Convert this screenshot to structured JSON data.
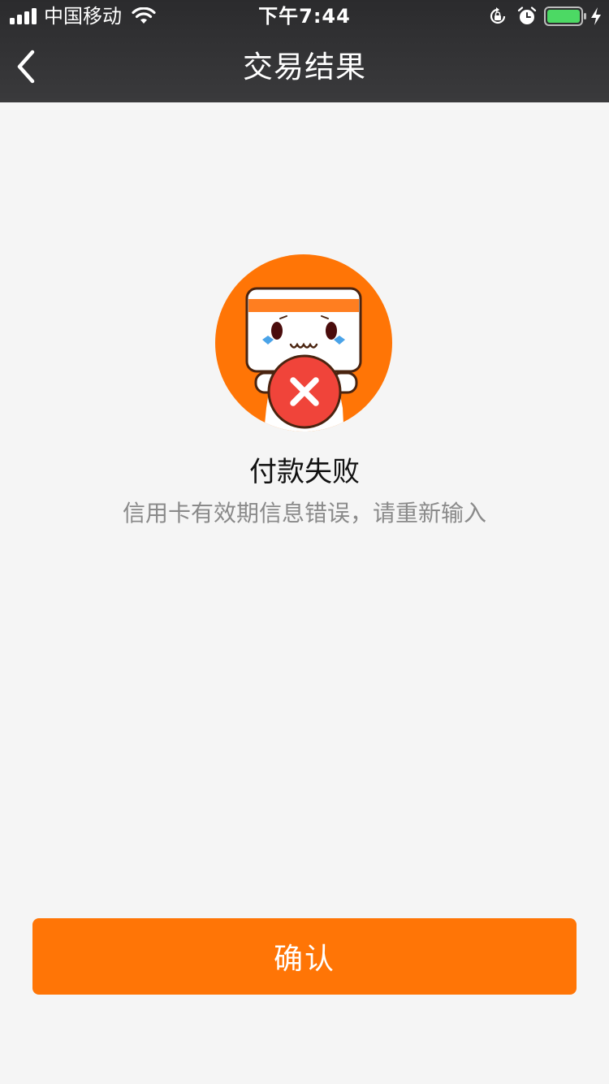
{
  "status_bar": {
    "carrier": "中国移动",
    "time": "下午7:44",
    "icons": [
      "signal-icon",
      "wifi-icon",
      "orientation-lock-icon",
      "alarm-icon",
      "battery-icon",
      "charging-icon"
    ],
    "battery_color": "#4cd964"
  },
  "nav": {
    "back_icon": "chevron-left-icon",
    "title": "交易结果"
  },
  "result": {
    "illustration_icon": "failed-mascot-icon",
    "title": "付款失败",
    "description": "信用卡有效期信息错误，请重新输入"
  },
  "footer": {
    "confirm_label": "确认"
  },
  "colors": {
    "accent": "#ff7506",
    "error": "#f0443a",
    "header_bg": "#2f2f31"
  }
}
